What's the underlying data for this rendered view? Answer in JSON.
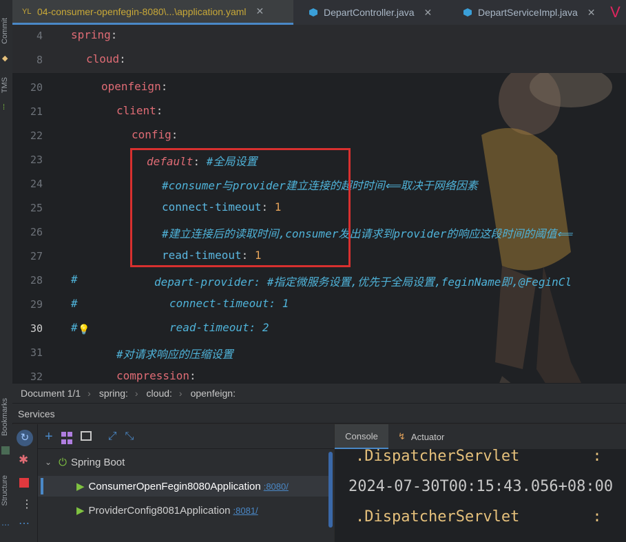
{
  "tabs": [
    {
      "label": "04-consumer-openfegin-8080\\...\\application.yaml",
      "icon": "yaml-file-icon",
      "active": true
    },
    {
      "label": "DepartController.java",
      "icon": "java-class-icon",
      "active": false
    },
    {
      "label": "DepartServiceImpl.java",
      "icon": "java-class-icon",
      "active": false
    }
  ],
  "tab_close": "✕",
  "left_strip": {
    "commit": "Commit",
    "tms": "TMS",
    "bookmarks": "Bookmarks",
    "structure": "Structure"
  },
  "editor": {
    "lines": [
      {
        "no": "4",
        "k": "spring",
        "p": ":"
      },
      {
        "no": "8",
        "k": "cloud",
        "p": ":"
      },
      {
        "no": "20",
        "k": "openfeign",
        "p": ":"
      },
      {
        "no": "21",
        "k": "client",
        "p": ":"
      },
      {
        "no": "22",
        "k": "config",
        "p": ":"
      },
      {
        "no": "23",
        "k": "default",
        "p": ":",
        "c": "#全局设置"
      },
      {
        "no": "24",
        "c": "#consumer与provider建立连接的超时时间⟸取决于网络因素"
      },
      {
        "no": "25",
        "k": "connect-timeout",
        "p": ":",
        "v": "1"
      },
      {
        "no": "26",
        "c": "#建立连接后的读取时间,consumer发出请求到provider的响应这段时间的阈值⟸"
      },
      {
        "no": "27",
        "k": "read-timeout",
        "p": ":",
        "v": "1"
      },
      {
        "no": "28",
        "h": "#",
        "k": "depart-provider",
        "p": ":",
        "c": "#指定微服务设置,优先于全局设置,feginName即,@FeginCl"
      },
      {
        "no": "29",
        "h": "#",
        "k": "connect-timeout",
        "p": ":",
        "v": "1"
      },
      {
        "no": "30",
        "h": "#",
        "k": "read-timeout",
        "p": ":",
        "v": "2"
      },
      {
        "no": "31",
        "c": "#对请求响应的压缩设置"
      },
      {
        "no": "32",
        "k": "compression",
        "p": ":"
      }
    ]
  },
  "breadcrumb": [
    "Document 1/1",
    "spring:",
    "cloud:",
    "openfeign:"
  ],
  "services": {
    "title": "Services",
    "group": "Spring Boot",
    "apps": [
      {
        "name": "ConsumerOpenFegin8080Application",
        "port": ":8080/"
      },
      {
        "name": "ProviderConfig8081Application",
        "port": ":8081/"
      }
    ],
    "console_tabs": [
      "Console",
      "Actuator"
    ],
    "console_lines": [
      ".DispatcherServlet        :",
      "2024-07-30T00:15:43.056+08:00",
      ".DispatcherServlet        :"
    ]
  },
  "colors": {
    "accent": "#4a88c7",
    "highlight_box": "#d8302f",
    "run": "#7fc241"
  }
}
